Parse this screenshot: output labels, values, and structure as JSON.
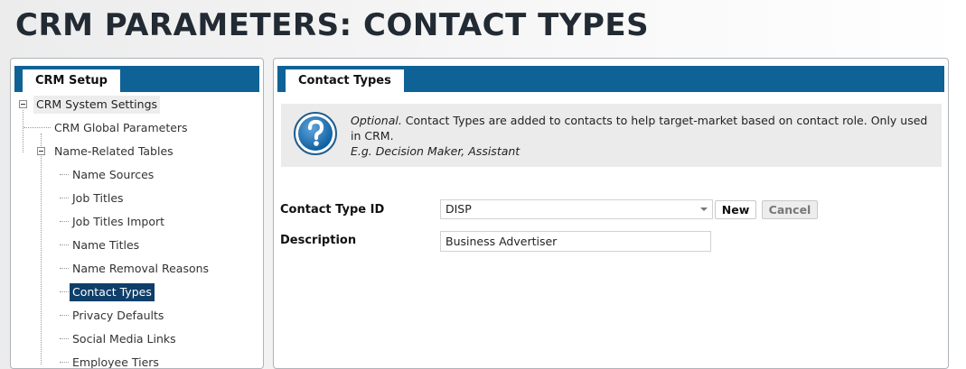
{
  "page_title": "CRM PARAMETERS: CONTACT TYPES",
  "left_panel": {
    "tab_label": "CRM Setup",
    "tree": {
      "root": "CRM System Settings",
      "global_parameters": "CRM Global Parameters",
      "name_related": "Name-Related Tables",
      "children": [
        "Name Sources",
        "Job Titles",
        "Job Titles Import",
        "Name Titles",
        "Name Removal Reasons",
        "Contact Types",
        "Privacy Defaults",
        "Social Media Links",
        "Employee Tiers"
      ],
      "selected": "Contact Types"
    }
  },
  "right_panel": {
    "tab_label": "Contact Types",
    "info": {
      "optional_label": "Optional.",
      "text": " Contact Types are added to contacts to help target-market based on contact role. Only used in CRM.",
      "example": "E.g. Decision Maker, Assistant"
    },
    "form": {
      "contact_type_id_label": "Contact Type ID",
      "contact_type_id_value": "DISP",
      "new_button": "New",
      "cancel_button": "Cancel",
      "description_label": "Description",
      "description_value": "Business Advertiser"
    }
  },
  "colors": {
    "accent_blue": "#0e6296",
    "selected_bg": "#0e3e6a",
    "info_bg": "#ebebeb"
  },
  "icons": [
    "expand-collapse-icon",
    "help-question-icon",
    "dropdown-arrow-icon"
  ]
}
